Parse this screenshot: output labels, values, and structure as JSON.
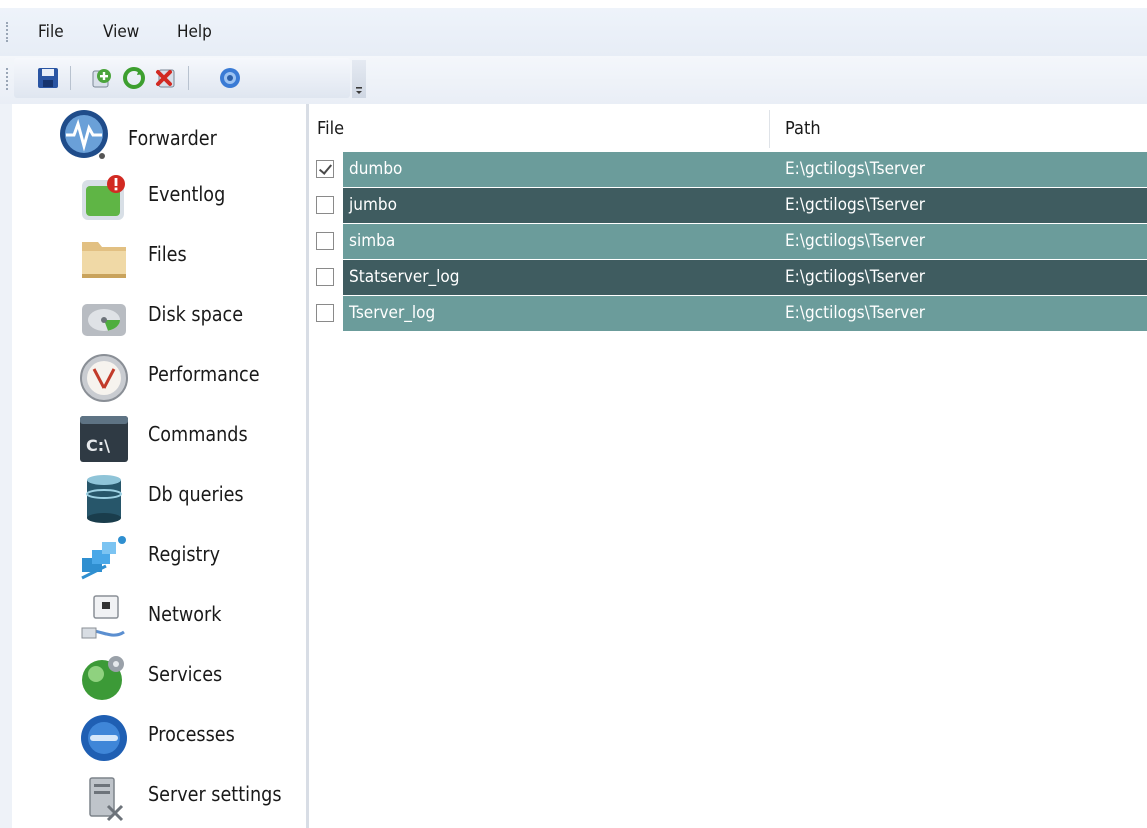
{
  "menu": {
    "items": [
      "File",
      "View",
      "Help"
    ]
  },
  "toolbar": {
    "buttons": [
      "save-icon",
      "add-icon",
      "refresh-icon",
      "remove-icon",
      "help-icon"
    ]
  },
  "sidebar": {
    "items": [
      {
        "label": "Forwarder",
        "icon": "forwarder-icon"
      },
      {
        "label": "Eventlog",
        "icon": "eventlog-icon"
      },
      {
        "label": "Files",
        "icon": "folder-icon"
      },
      {
        "label": "Disk space",
        "icon": "disk-icon"
      },
      {
        "label": "Performance",
        "icon": "gauge-icon"
      },
      {
        "label": "Commands",
        "icon": "console-icon"
      },
      {
        "label": "Db queries",
        "icon": "database-icon"
      },
      {
        "label": "Registry",
        "icon": "registry-icon"
      },
      {
        "label": "Network",
        "icon": "network-icon"
      },
      {
        "label": "Services",
        "icon": "services-icon"
      },
      {
        "label": "Processes",
        "icon": "processes-icon"
      },
      {
        "label": "Server settings",
        "icon": "server-settings-icon"
      }
    ]
  },
  "list": {
    "columns": {
      "file": "File",
      "path": "Path"
    },
    "rows": [
      {
        "file": "dumbo",
        "path": "E:\\gctilogs\\Tserver",
        "checked": true
      },
      {
        "file": "jumbo",
        "path": "E:\\gctilogs\\Tserver",
        "checked": false
      },
      {
        "file": "simba",
        "path": "E:\\gctilogs\\Tserver",
        "checked": false
      },
      {
        "file": "Statserver_log",
        "path": "E:\\gctilogs\\Tserver",
        "checked": false
      },
      {
        "file": "Tserver_log",
        "path": "E:\\gctilogs\\Tserver",
        "checked": false
      }
    ]
  },
  "colors": {
    "row_light": "#6b9c9b",
    "row_dark": "#3f5c60",
    "chrome": "#e7edf6"
  }
}
